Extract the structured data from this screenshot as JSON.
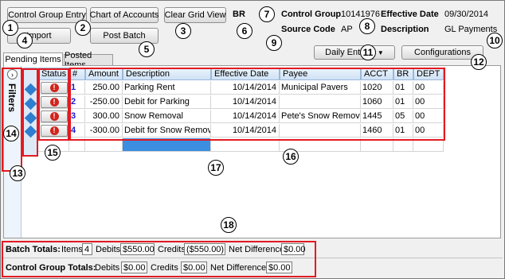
{
  "toolbar": {
    "control_group_entry": "Control Group Entry",
    "chart_of_accounts": "Chart of Accounts",
    "clear_grid_view": "Clear Grid View",
    "import": "Import",
    "post_batch": "Post Batch"
  },
  "header": {
    "br_label": "BR",
    "control_group_label": "Control Group",
    "control_group_value": "10141976",
    "effective_date_label": "Effective Date",
    "effective_date_value": "09/30/2014",
    "source_code_label": "Source Code",
    "source_code_value": "AP",
    "description_label": "Description",
    "description_value": "GL Payments"
  },
  "tabs": [
    "Pending Items",
    "Posted Items"
  ],
  "actions": {
    "daily_entries": "Daily Entries",
    "configurations": "Configurations"
  },
  "filters_label": "Filters",
  "grid": {
    "columns": [
      "Status",
      "#",
      "Amount",
      "Description",
      "Effective Date",
      "Payee",
      "ACCT",
      "BR",
      "DEPT"
    ],
    "rows": [
      {
        "num": "1",
        "amount": "250.00",
        "description": "Parking Rent",
        "date": "10/14/2014",
        "payee": "Municipal Pavers",
        "acct": "1020",
        "br": "01",
        "dept": "00"
      },
      {
        "num": "2",
        "amount": "-250.00",
        "description": "Debit for Parking",
        "date": "10/14/2014",
        "payee": "",
        "acct": "1060",
        "br": "01",
        "dept": "00"
      },
      {
        "num": "3",
        "amount": "300.00",
        "description": "Snow Removal",
        "date": "10/14/2014",
        "payee": "Pete's Snow Removal",
        "acct": "1445",
        "br": "05",
        "dept": "00"
      },
      {
        "num": "4",
        "amount": "-300.00",
        "description": "Debit for Snow Removal",
        "date": "10/14/2014",
        "payee": "",
        "acct": "1460",
        "br": "01",
        "dept": "00"
      }
    ]
  },
  "batch_totals": {
    "label": "Batch Totals:",
    "items_label": "Items",
    "items_value": "4",
    "debits_label": "Debits",
    "debits_value": "$550.00",
    "credits_label": "Credits",
    "credits_value": "($550.00)",
    "net_label": "Net Difference",
    "net_value": "$0.00"
  },
  "control_group_totals": {
    "label": "Control Group Totals:",
    "debits_label": "Debits",
    "debits_value": "$0.00",
    "credits_label": "Credits",
    "credits_value": "$0.00",
    "net_label": "Net Difference",
    "net_value": "$0.00"
  },
  "callouts": [
    "1",
    "2",
    "3",
    "4",
    "5",
    "6",
    "7",
    "8",
    "9",
    "10",
    "11",
    "12",
    "13",
    "14",
    "15",
    "16",
    "17",
    "18"
  ],
  "colors": {
    "accent": "#e21a22",
    "link_number": "#1a1ad0",
    "error": "#d0241c",
    "selection": "#3b8ee0"
  }
}
